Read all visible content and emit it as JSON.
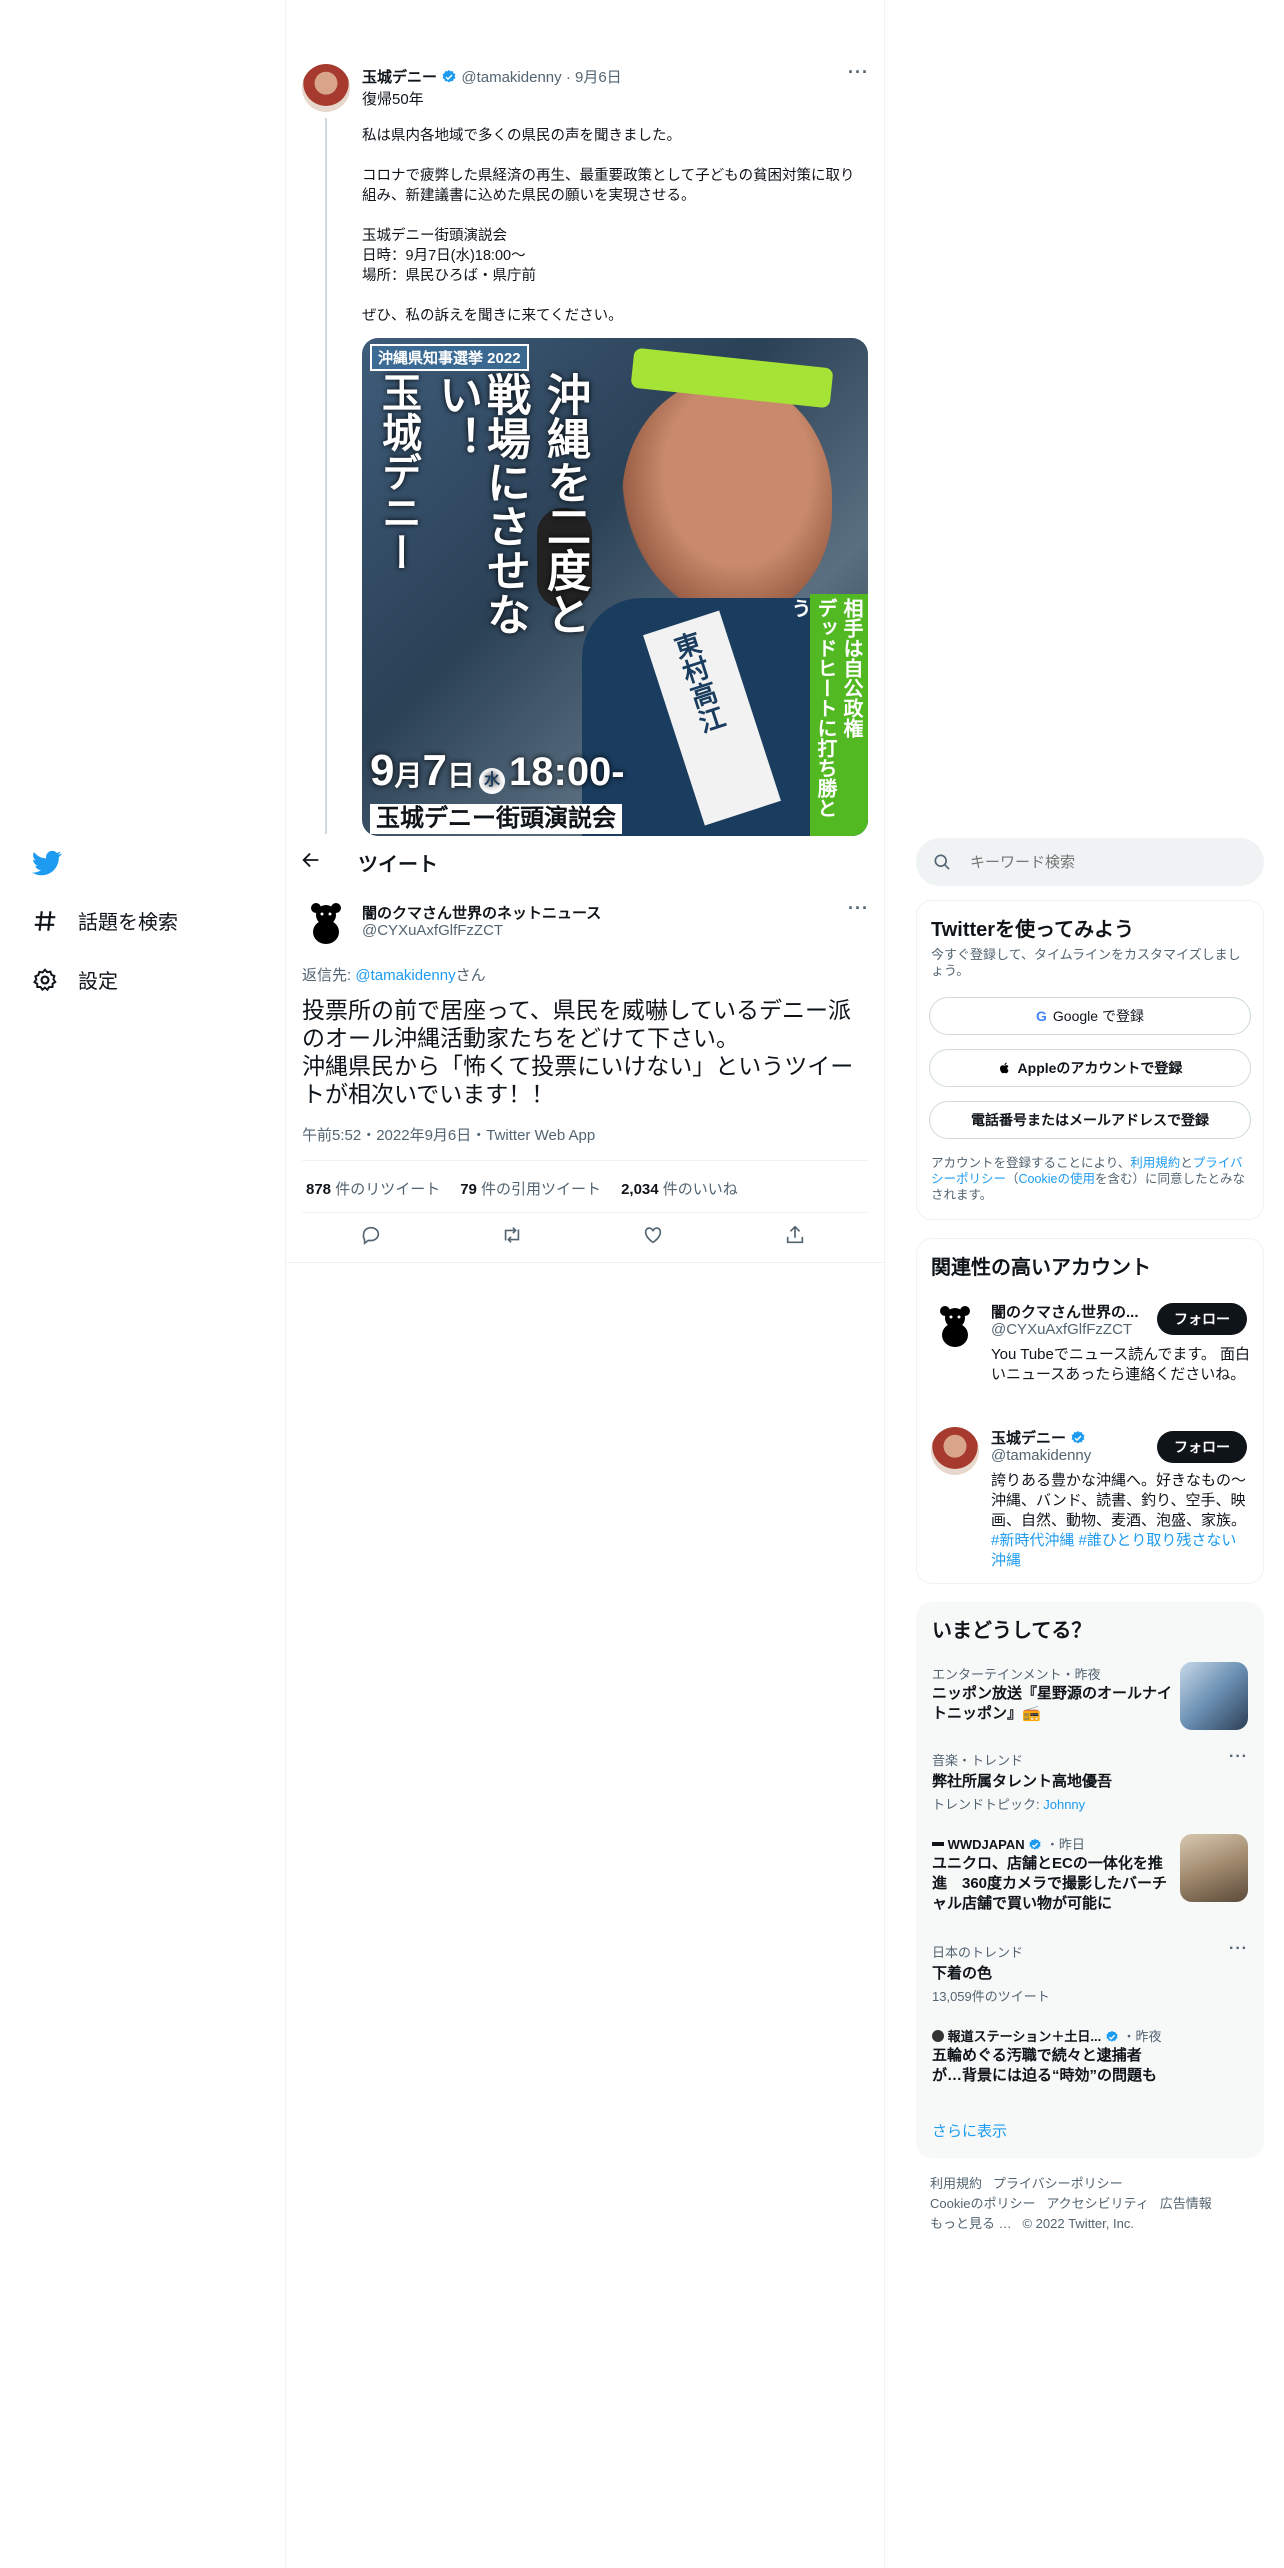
{
  "nav": {
    "explore_label": "話題を検索",
    "settings_label": "設定"
  },
  "quoted_tweet": {
    "name": "玉城デニー",
    "handle": "@tamakidenny",
    "date": "9月6日",
    "subtitle": "復帰50年",
    "body": "私は県内各地域で多くの県民の声を聞きました。\n\nコロナで疲弊した県経済の再生、最重要政策として子どもの貧困対策に取り組み、新建議書に込めた県民の願いを実現させる。\n\n玉城デニー街頭演説会\n日時：9月7日(水)18:00〜\n場所：県民ひろば・県庁前\n\nぜひ、私の訴えを聞きに来てください。",
    "poster": {
      "badge": "沖縄県知事選挙 2022",
      "headline_col1": "沖縄を二度と",
      "headline_col2": "戦場にさせない！",
      "headline_col3": "玉城デニー",
      "green_col1": "相手は自公政権",
      "green_col2": "デッドヒートに打ち勝とう",
      "sash": "東村高江",
      "date_month": "9",
      "date_month_unit": "月",
      "date_day": "7",
      "date_day_unit": "日",
      "date_weekday": "水",
      "date_time": "18:00-",
      "event": "玉城デニー街頭演説会"
    }
  },
  "header": {
    "title": "ツイート"
  },
  "main_tweet": {
    "name": "闇のクマさん世界のネットニュース",
    "handle": "@CYXuAxfGlfFzZCT",
    "reply_prefix": "返信先: ",
    "reply_handle": "@tamakidenny",
    "reply_suffix": "さん",
    "body": "投票所の前で居座って、県民を威嚇しているデニー派のオール沖縄活動家たちをどけて下さい。\n沖縄県民から「怖くて投票にいけない」というツイートが相次いでいます！！",
    "meta": "午前5:52・2022年9月6日・Twitter Web App",
    "retweets_count": "878",
    "retweets_label": " 件のリツイート",
    "quotes_count": "79",
    "quotes_label": " 件の引用ツイート",
    "likes_count": "2,034",
    "likes_label": " 件のいいね"
  },
  "search": {
    "placeholder": "キーワード検索"
  },
  "signup": {
    "title": "Twitterを使ってみよう",
    "subtitle": "今すぐ登録して、タイムラインをカスタマイズしましょう。",
    "google": "Google で登録",
    "apple": "Appleのアカウントで登録",
    "phone": "電話番号またはメールアドレスで登録",
    "terms_prefix": "アカウントを登録することにより、",
    "terms_link1": "利用規約",
    "terms_mid1": "と",
    "terms_link2": "プライバシーポリシー",
    "terms_mid2": "（",
    "terms_link3": "Cookieの使用",
    "terms_suffix": "を含む）に同意したとみなされます。"
  },
  "related": {
    "title": "関連性の高いアカウント",
    "accounts": [
      {
        "name": "闇のクマさん世界の...",
        "handle": "@CYXuAxfGlfFzZCT",
        "bio": "You Tubeでニュース読んでます。 面白いニュースあったら連絡くださいね。",
        "follow": "フォロー"
      },
      {
        "name": "玉城デニー",
        "handle": "@tamakidenny",
        "bio": "誇りある豊かな沖縄へ。好きなもの〜沖縄、バンド、読書、釣り、空手、映画、自然、動物、麦酒、泡盛、家族。",
        "hashtag1": "#新時代沖縄",
        "hashtag2": "#誰ひとり取り残さない沖縄",
        "follow": "フォロー"
      }
    ]
  },
  "trends": {
    "title": "いまどうしてる？",
    "items": [
      {
        "meta": "エンターテインメント・昨夜",
        "title": "ニッポン放送『星野源のオールナイトニッポン』📻"
      },
      {
        "meta": "音楽・トレンド",
        "title": "弊社所属タレント高地優吾",
        "sub_prefix": "トレンドトピック: ",
        "sub_link": "Johnny"
      },
      {
        "meta_source": "WWDJAPAN",
        "meta_time": "・昨日",
        "title": "ユニクロ、店舗とECの一体化を推進　360度カメラで撮影したバーチャル店舗で買い物が可能に"
      },
      {
        "meta": "日本のトレンド",
        "title": "下着の色",
        "sub": "13,059件のツイート"
      },
      {
        "meta_source": "報道ステーション＋土日...",
        "meta_time": "・昨夜",
        "title": "五輪めぐる汚職で続々と逮捕者が…背景には迫る“時効”の問題も"
      }
    ],
    "show_more": "さらに表示"
  },
  "footer": {
    "terms": "利用規約",
    "privacy": "プライバシーポリシー",
    "cookie": "Cookieのポリシー",
    "accessibility": "アクセシビリティ",
    "ads": "広告情報",
    "more": "もっと見る …",
    "copyright": "© 2022 Twitter, Inc."
  },
  "colors": {
    "twitter_blue": "#1d9bf0",
    "text": "#0f1419",
    "muted": "#536471"
  }
}
